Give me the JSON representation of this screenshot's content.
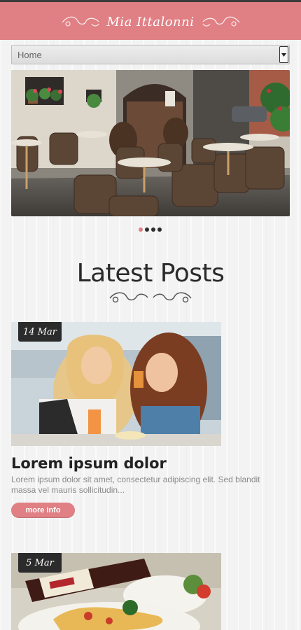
{
  "header": {
    "brand": "Mia Ittalonni"
  },
  "nav": {
    "selected": "Home"
  },
  "slider": {
    "dots": 4,
    "active_index": 0
  },
  "section": {
    "title": "Latest Posts"
  },
  "posts": [
    {
      "date": "14 Mar",
      "title": "Lorem ipsum dolor",
      "excerpt": "Lorem ipsum dolor sit amet, consectetur adipiscing elit. Sed blandit massa vel mauris sollicitudin...",
      "button": "more info"
    },
    {
      "date": "5 Mar"
    }
  ],
  "colors": {
    "accent": "#e07f84",
    "dark": "#2b2b2b"
  }
}
